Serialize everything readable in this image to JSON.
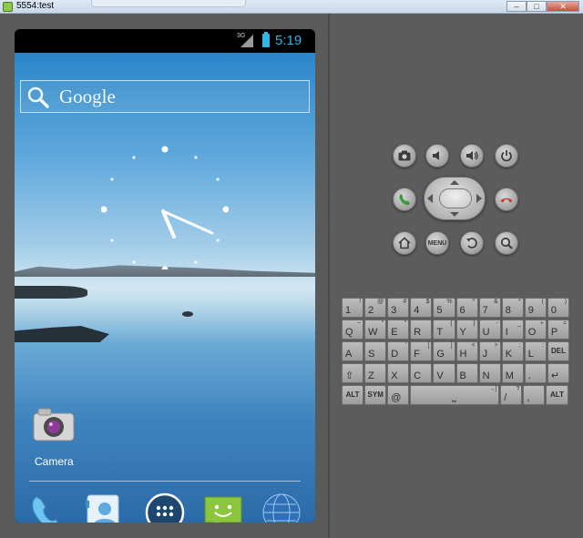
{
  "window": {
    "title": "5554:test",
    "buttons": {
      "minimize": "–",
      "maximize": "□",
      "close": "✕"
    }
  },
  "status_bar": {
    "network": "3G",
    "time": "5:19"
  },
  "search": {
    "label": "Google"
  },
  "apps": {
    "camera_label": "Camera",
    "dock": [
      "phone-icon",
      "contacts-icon",
      "app-drawer-icon",
      "messaging-icon",
      "browser-icon"
    ]
  },
  "hardware_buttons": {
    "menu_label": "MENU"
  },
  "colors": {
    "status_accent": "#33b5e5",
    "call_green": "#3b9a3b",
    "end_red": "#c23b32"
  },
  "keyboard": {
    "rows": [
      [
        {
          "main": "1",
          "sub": "!"
        },
        {
          "main": "2",
          "sub": "@"
        },
        {
          "main": "3",
          "sub": "#"
        },
        {
          "main": "4",
          "sub": "$"
        },
        {
          "main": "5",
          "sub": "%"
        },
        {
          "main": "6",
          "sub": "^"
        },
        {
          "main": "7",
          "sub": "&"
        },
        {
          "main": "8",
          "sub": "*"
        },
        {
          "main": "9",
          "sub": "("
        },
        {
          "main": "0",
          "sub": ")"
        }
      ],
      [
        {
          "main": "Q",
          "sub": "~"
        },
        {
          "main": "W",
          "sub": "\""
        },
        {
          "main": "E",
          "sub": "\""
        },
        {
          "main": "R",
          "sub": ""
        },
        {
          "main": "T",
          "sub": "{"
        },
        {
          "main": "Y",
          "sub": "}"
        },
        {
          "main": "U",
          "sub": "-"
        },
        {
          "main": "I",
          "sub": "_"
        },
        {
          "main": "O",
          "sub": "+"
        },
        {
          "main": "P",
          "sub": "="
        }
      ],
      [
        {
          "main": "A",
          "sub": ""
        },
        {
          "main": "S",
          "sub": ""
        },
        {
          "main": "D",
          "sub": "'"
        },
        {
          "main": "F",
          "sub": "["
        },
        {
          "main": "G",
          "sub": "]"
        },
        {
          "main": "H",
          "sub": "<"
        },
        {
          "main": "J",
          "sub": ">"
        },
        {
          "main": "K",
          "sub": ";"
        },
        {
          "main": "L",
          "sub": ":"
        },
        {
          "main": "DEL",
          "sub": ""
        }
      ],
      [
        {
          "main": "⇧",
          "sub": ""
        },
        {
          "main": "Z",
          "sub": ""
        },
        {
          "main": "X",
          "sub": ""
        },
        {
          "main": "C",
          "sub": ""
        },
        {
          "main": "V",
          "sub": ""
        },
        {
          "main": "B",
          "sub": ""
        },
        {
          "main": "N",
          "sub": ""
        },
        {
          "main": "M",
          "sub": ""
        },
        {
          "main": ".",
          "sub": ""
        },
        {
          "main": "↵",
          "sub": ""
        }
      ],
      [
        {
          "main": "ALT"
        },
        {
          "main": "SYM"
        },
        {
          "main": "@"
        },
        {
          "main": "⎵",
          "sub": "→|"
        },
        {
          "main": "/",
          "sub": "?"
        },
        {
          "main": ",",
          "sub": ""
        },
        {
          "main": "ALT"
        }
      ]
    ]
  }
}
